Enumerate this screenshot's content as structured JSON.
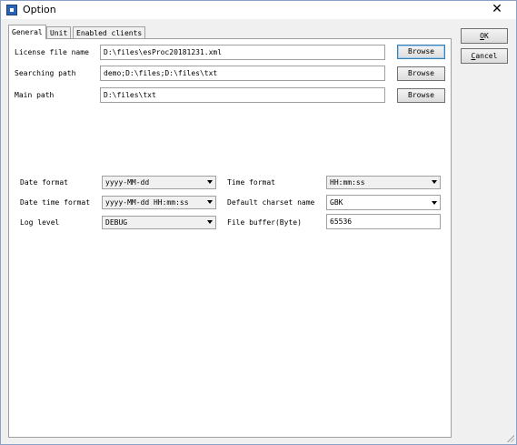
{
  "window": {
    "title": "Option"
  },
  "tabs": [
    {
      "label": "General",
      "active": true
    },
    {
      "label": "Unit",
      "active": false
    },
    {
      "label": "Enabled clients",
      "active": false
    }
  ],
  "general": {
    "license_label": "License file name",
    "license_value": "D:\\files\\esProc20181231.xml",
    "searching_label": "Searching path",
    "searching_value": "demo;D:\\files;D:\\files\\txt",
    "main_label": "Main path",
    "main_value": "D:\\files\\txt",
    "browse_label": "Browse",
    "date_format_label": "Date format",
    "date_format_value": "yyyy-MM-dd",
    "datetime_format_label": "Date time format",
    "datetime_format_value": "yyyy-MM-dd HH:mm:ss",
    "log_level_label": "Log level",
    "log_level_value": "DEBUG",
    "time_format_label": "Time format",
    "time_format_value": "HH:mm:ss",
    "charset_label": "Default charset name",
    "charset_value": "GBK",
    "file_buffer_label": "File buffer(Byte)",
    "file_buffer_value": "65536"
  },
  "side_buttons": {
    "ok_underlined": "O",
    "ok_rest": "K",
    "cancel_underlined": "C",
    "cancel_rest": "ancel"
  },
  "icons": {
    "app": "app-icon",
    "close": "close-icon",
    "dropdown": "chevron-down-icon"
  },
  "colors": {
    "accent": "#2b63b6",
    "focus_border": "#3c7fb1"
  }
}
